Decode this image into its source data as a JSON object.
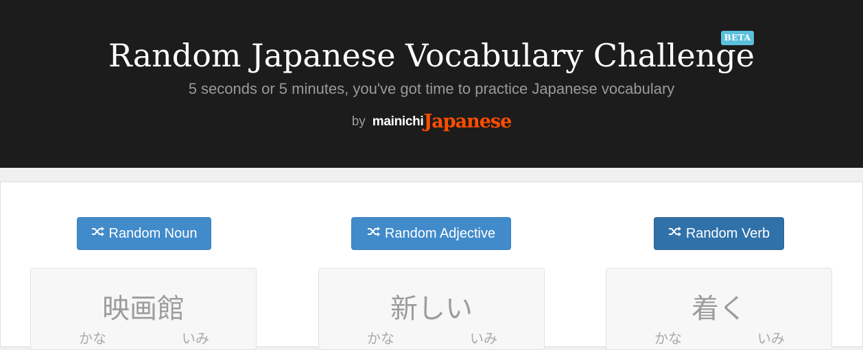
{
  "header": {
    "title": "Random Japanese Vocabulary Challenge",
    "badge": "BETA",
    "subtitle": "5 seconds or 5 minutes, you've got time to practice Japanese vocabulary",
    "by": "by",
    "logo_part1": "mainichi",
    "logo_part2": "Japanese"
  },
  "buttons": [
    {
      "label": "Random Noun",
      "icon": "shuffle-icon"
    },
    {
      "label": "Random Adjective",
      "icon": "shuffle-icon"
    },
    {
      "label": "Random Verb",
      "icon": "shuffle-icon"
    }
  ],
  "cards": [
    {
      "word": "映画館",
      "kana_label": "かな",
      "meaning_label": "いみ"
    },
    {
      "word": "新しい",
      "kana_label": "かな",
      "meaning_label": "いみ"
    },
    {
      "word": "着く",
      "kana_label": "かな",
      "meaning_label": "いみ"
    }
  ],
  "colors": {
    "header_bg": "#1c1c1c",
    "button": "#428bca",
    "button_active": "#3071a9",
    "badge": "#5bc0de",
    "logo_accent": "#ff4d00"
  }
}
